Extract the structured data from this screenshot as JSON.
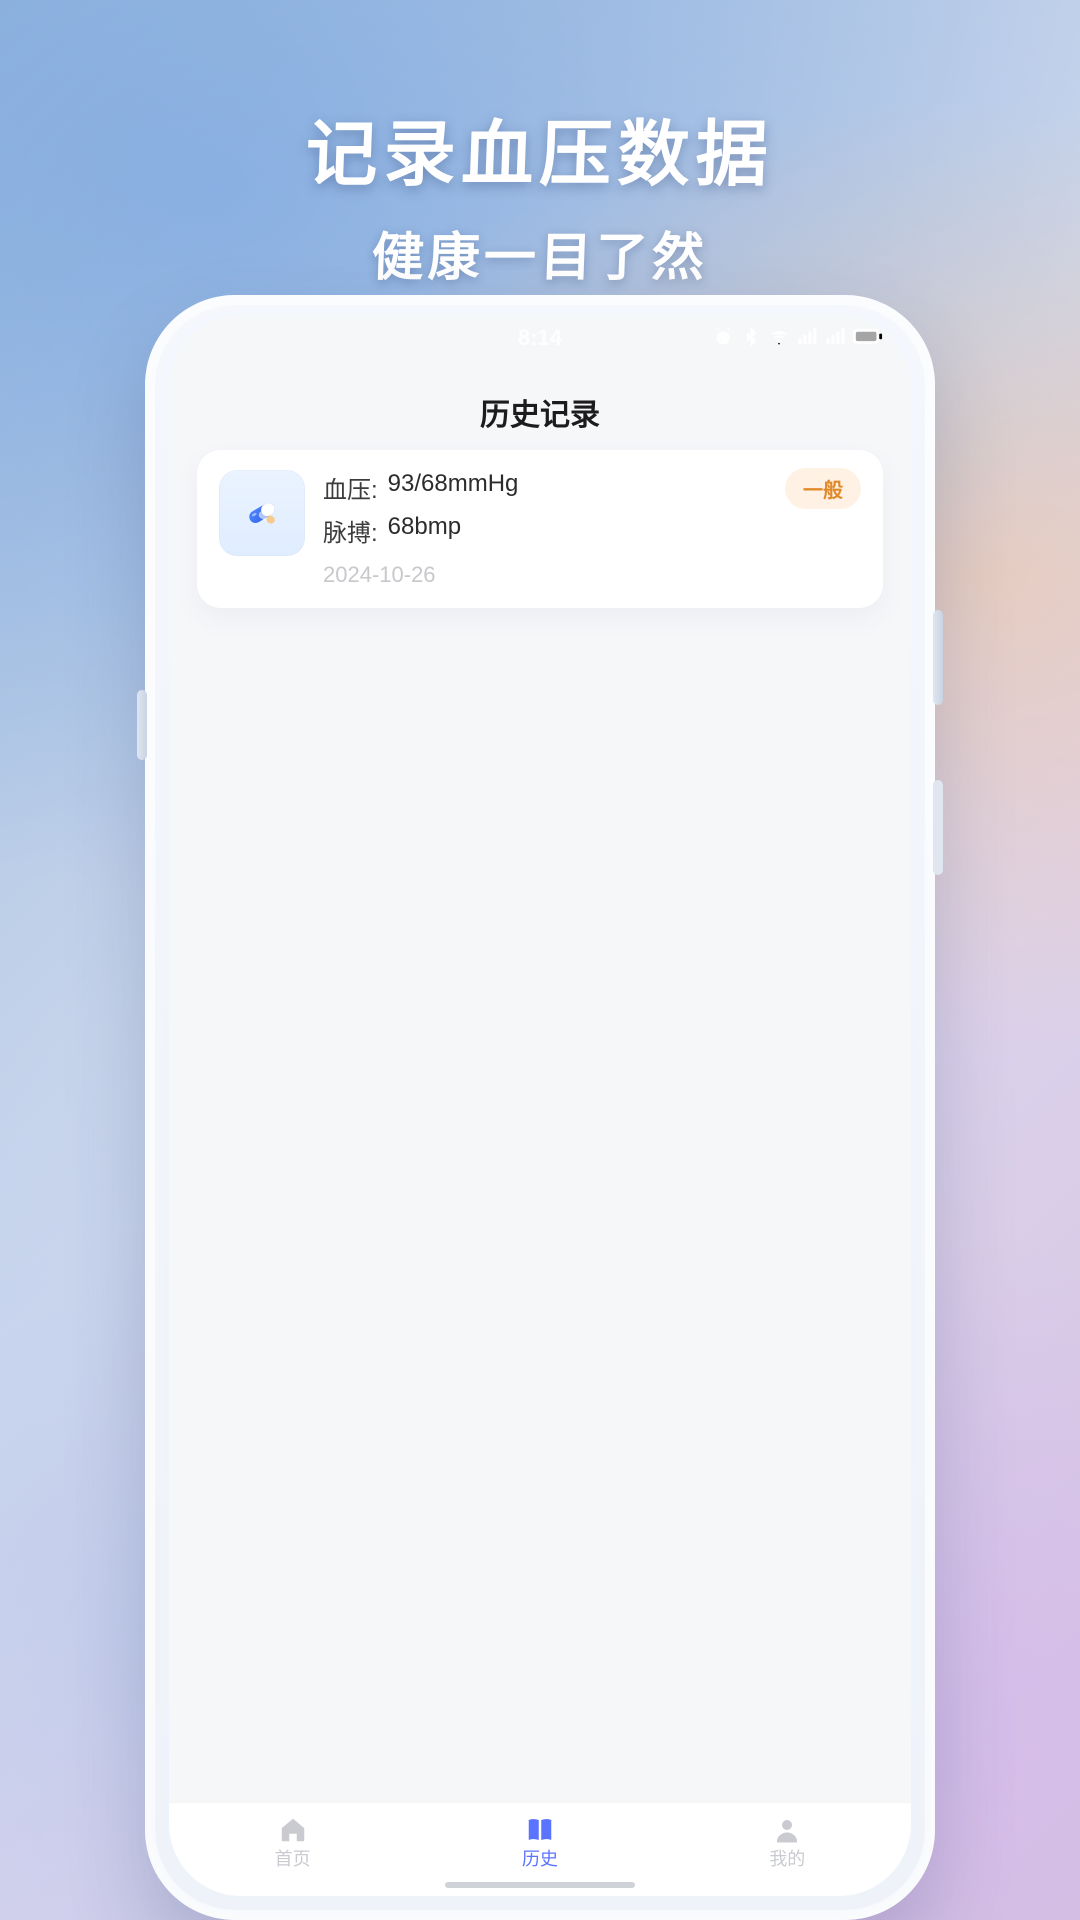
{
  "marketing": {
    "headline": "记录血压数据",
    "subhead": "健康一目了然"
  },
  "status": {
    "time": "8:14"
  },
  "page": {
    "title": "历史记录"
  },
  "record": {
    "bp_label": "血压:",
    "bp_value": "93/68mmHg",
    "pulse_label": "脉搏:",
    "pulse_value": "68bmp",
    "date": "2024-10-26",
    "status_badge": "一般"
  },
  "tabs": {
    "home": "首页",
    "history": "历史",
    "mine": "我的"
  }
}
